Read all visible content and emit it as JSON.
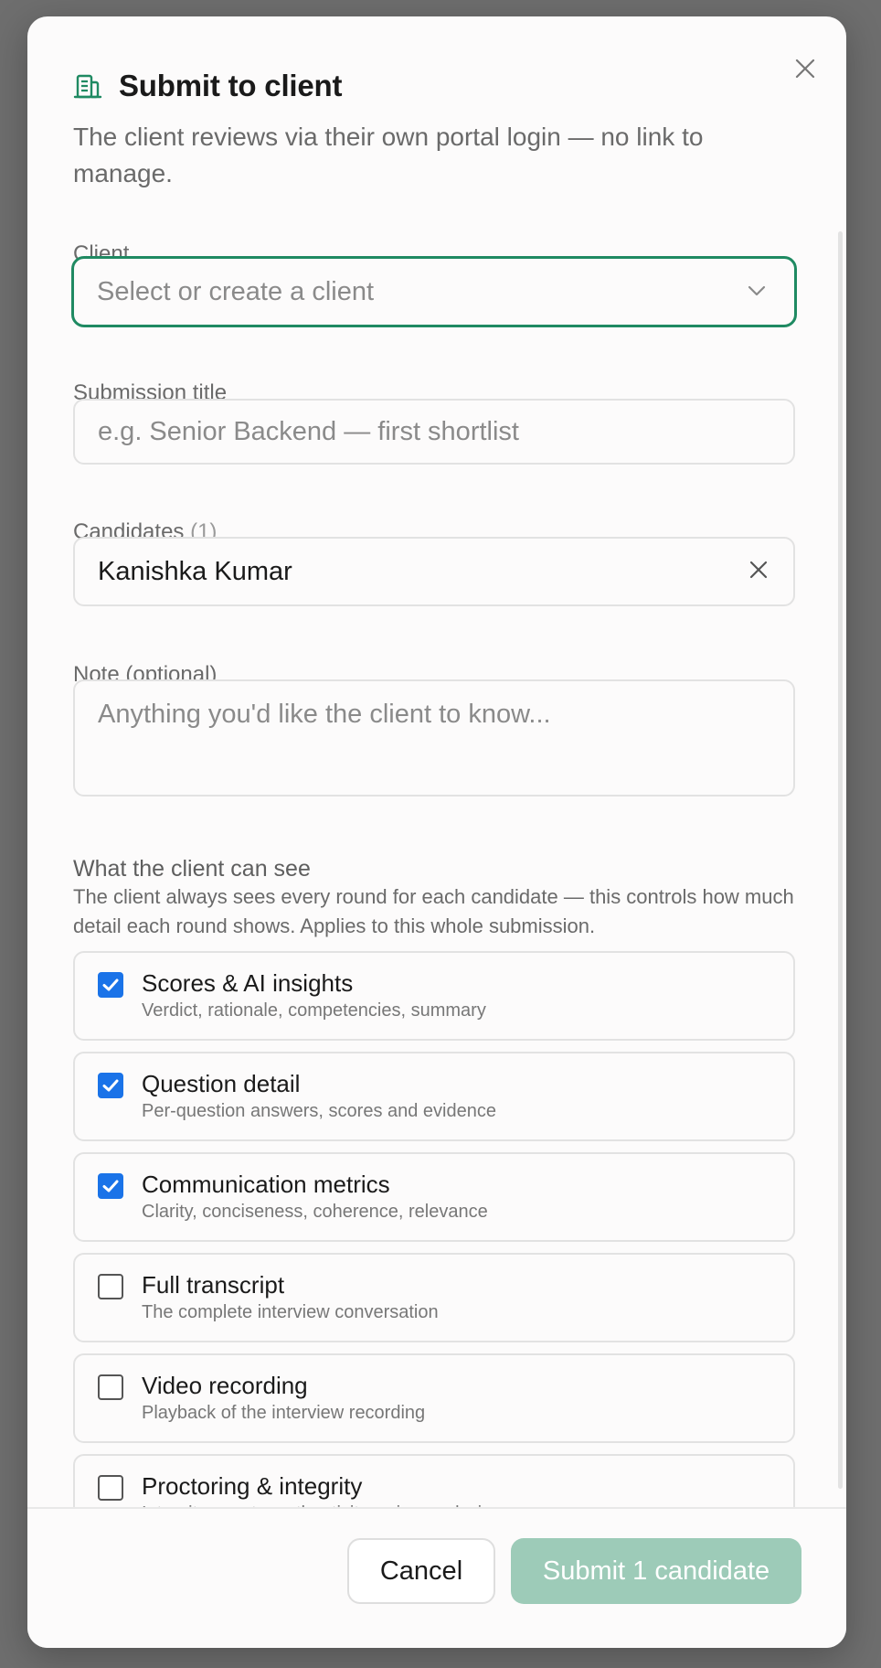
{
  "dialog": {
    "title": "Submit to client",
    "subtitle": "The client reviews via their own portal login — no link to manage."
  },
  "client": {
    "label": "Client",
    "placeholder": "Select or create a client"
  },
  "submission_title": {
    "label": "Submission title",
    "placeholder": "e.g. Senior Backend — first shortlist"
  },
  "candidates": {
    "label": "Candidates",
    "count": "(1)",
    "selected": "Kanishka Kumar"
  },
  "note": {
    "label": "Note (optional)",
    "placeholder": "Anything you'd like the client to know..."
  },
  "visibility": {
    "title": "What the client can see",
    "description": "The client always sees every round for each candidate — this controls how much detail each round shows. Applies to this whole submission.",
    "options": [
      {
        "title": "Scores & AI insights",
        "desc": "Verdict, rationale, competencies, summary",
        "checked": true
      },
      {
        "title": "Question detail",
        "desc": "Per-question answers, scores and evidence",
        "checked": true
      },
      {
        "title": "Communication metrics",
        "desc": "Clarity, conciseness, coherence, relevance",
        "checked": true
      },
      {
        "title": "Full transcript",
        "desc": "The complete interview conversation",
        "checked": false
      },
      {
        "title": "Video recording",
        "desc": "Playback of the interview recording",
        "checked": false
      },
      {
        "title": "Proctoring & integrity",
        "desc": "Integrity events, authenticity, voice analysis",
        "checked": false
      }
    ]
  },
  "footer": {
    "cancel_label": "Cancel",
    "submit_label": "Submit 1 candidate"
  },
  "colors": {
    "accent": "#1f8a62",
    "submit_disabled": "#9dcbb8",
    "checkbox": "#1a73e8"
  }
}
